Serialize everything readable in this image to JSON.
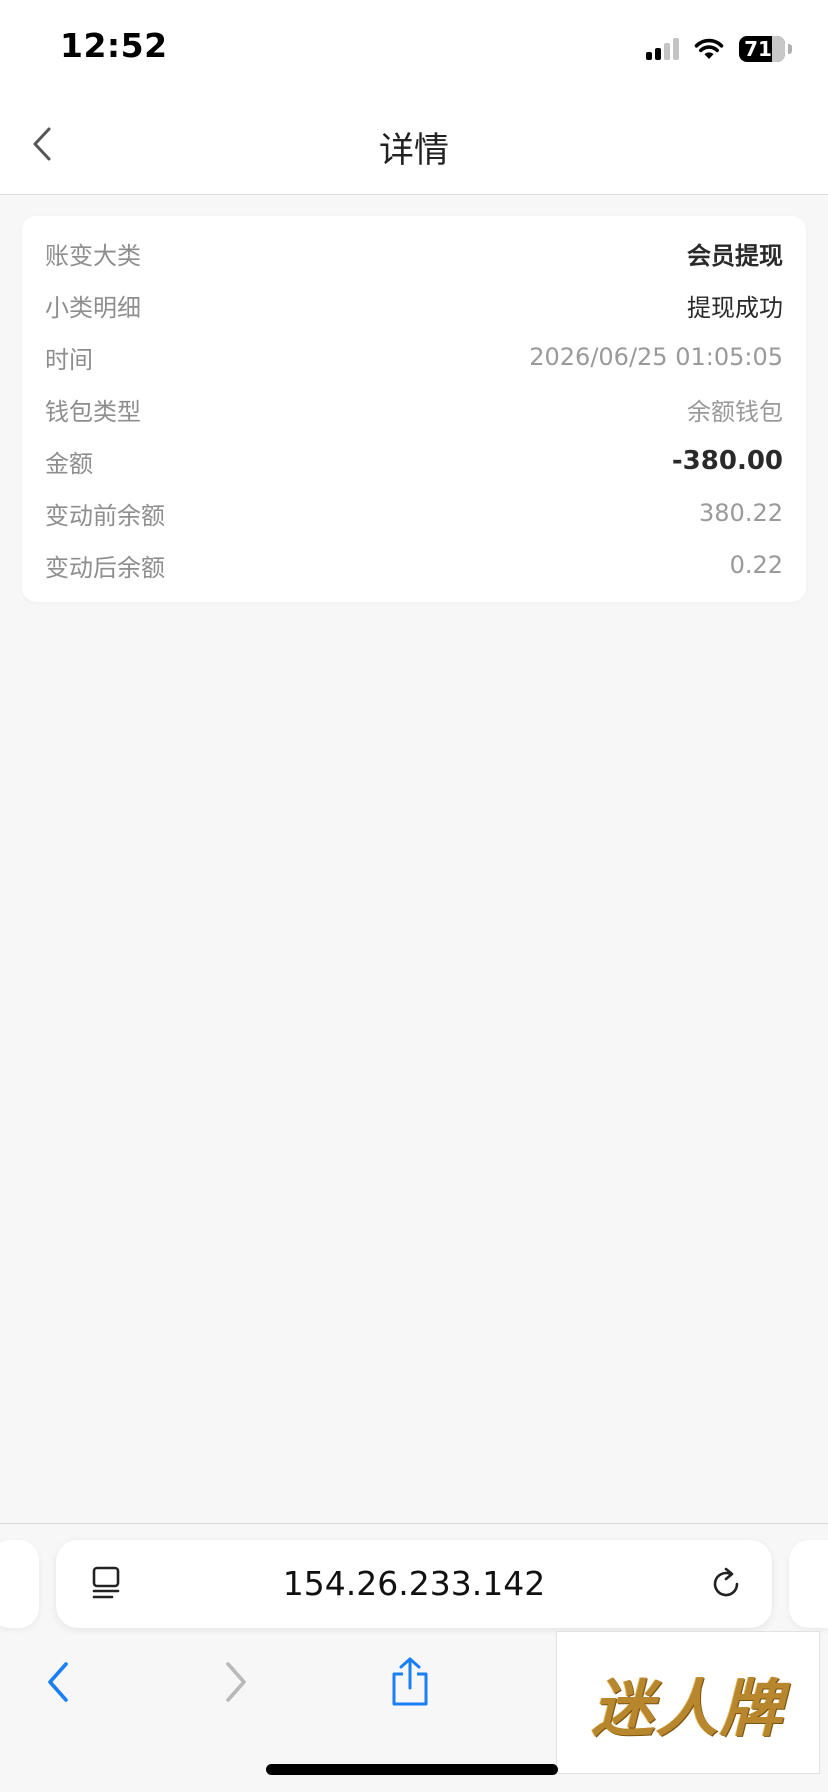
{
  "status_bar": {
    "time": "12:52",
    "battery_level": "71",
    "icons": [
      "cellular-signal-icon",
      "wifi-icon",
      "battery-icon"
    ]
  },
  "nav": {
    "title": "详情",
    "back_icon": "chevron-left-icon"
  },
  "detail": {
    "rows": [
      {
        "label": "账变大类",
        "value": "会员提现"
      },
      {
        "label": "小类明细",
        "value": "提现成功"
      },
      {
        "label": "时间",
        "value": "2026/06/25 01:05:05"
      },
      {
        "label": "钱包类型",
        "value": "余额钱包"
      },
      {
        "label": "金额",
        "value": "-380.00"
      },
      {
        "label": "变动前余额",
        "value": "380.22"
      },
      {
        "label": "变动后余额",
        "value": "0.22"
      }
    ]
  },
  "browser": {
    "address": "154.26.233.142",
    "reader_icon": "reader-mode-icon",
    "reload_icon": "reload-icon",
    "toolbar_icons": [
      "back-arrow-icon",
      "forward-arrow-icon",
      "share-icon"
    ]
  },
  "watermark": {
    "text": "迷人牌"
  },
  "colors": {
    "accent_blue": "#1a7ef5",
    "disabled_gray": "#b9b9b9",
    "background": "#f7f7f7"
  }
}
